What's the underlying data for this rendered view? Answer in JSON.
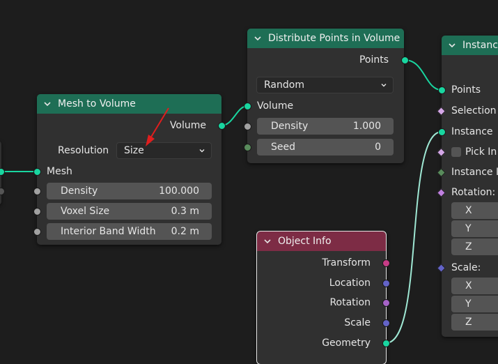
{
  "nodes": {
    "mesh_to_volume": {
      "title": "Mesh to Volume",
      "output_volume": "Volume",
      "resolution_label": "Resolution",
      "resolution_value": "Size",
      "input_mesh": "Mesh",
      "fields": [
        {
          "label": "Density",
          "value": "100.000"
        },
        {
          "label": "Voxel Size",
          "value": "0.3 m"
        },
        {
          "label": "Interior Band Width",
          "value": "0.2 m"
        }
      ]
    },
    "distribute_points": {
      "title": "Distribute Points in Volume",
      "output_points": "Points",
      "mode": "Random",
      "input_volume": "Volume",
      "fields": [
        {
          "label": "Density",
          "value": "1.000"
        },
        {
          "label": "Seed",
          "value": "0"
        }
      ]
    },
    "instance_on_points": {
      "title": "Instanc",
      "inputs": [
        "Points",
        "Selection",
        "Instance",
        "Pick In",
        "Instance I",
        "Rotation:",
        "X",
        "Y",
        "Z",
        "Scale:",
        "X",
        "Y",
        "Z"
      ]
    },
    "object_info": {
      "title": "Object Info",
      "outputs": [
        "Transform",
        "Location",
        "Rotation",
        "Scale",
        "Geometry"
      ]
    }
  },
  "colors": {
    "geometry_header": "#1e6e55",
    "object_header": "#7d2c45",
    "geometry_socket": "#19d6a0",
    "annotation_arrow": "#e01e1e"
  }
}
